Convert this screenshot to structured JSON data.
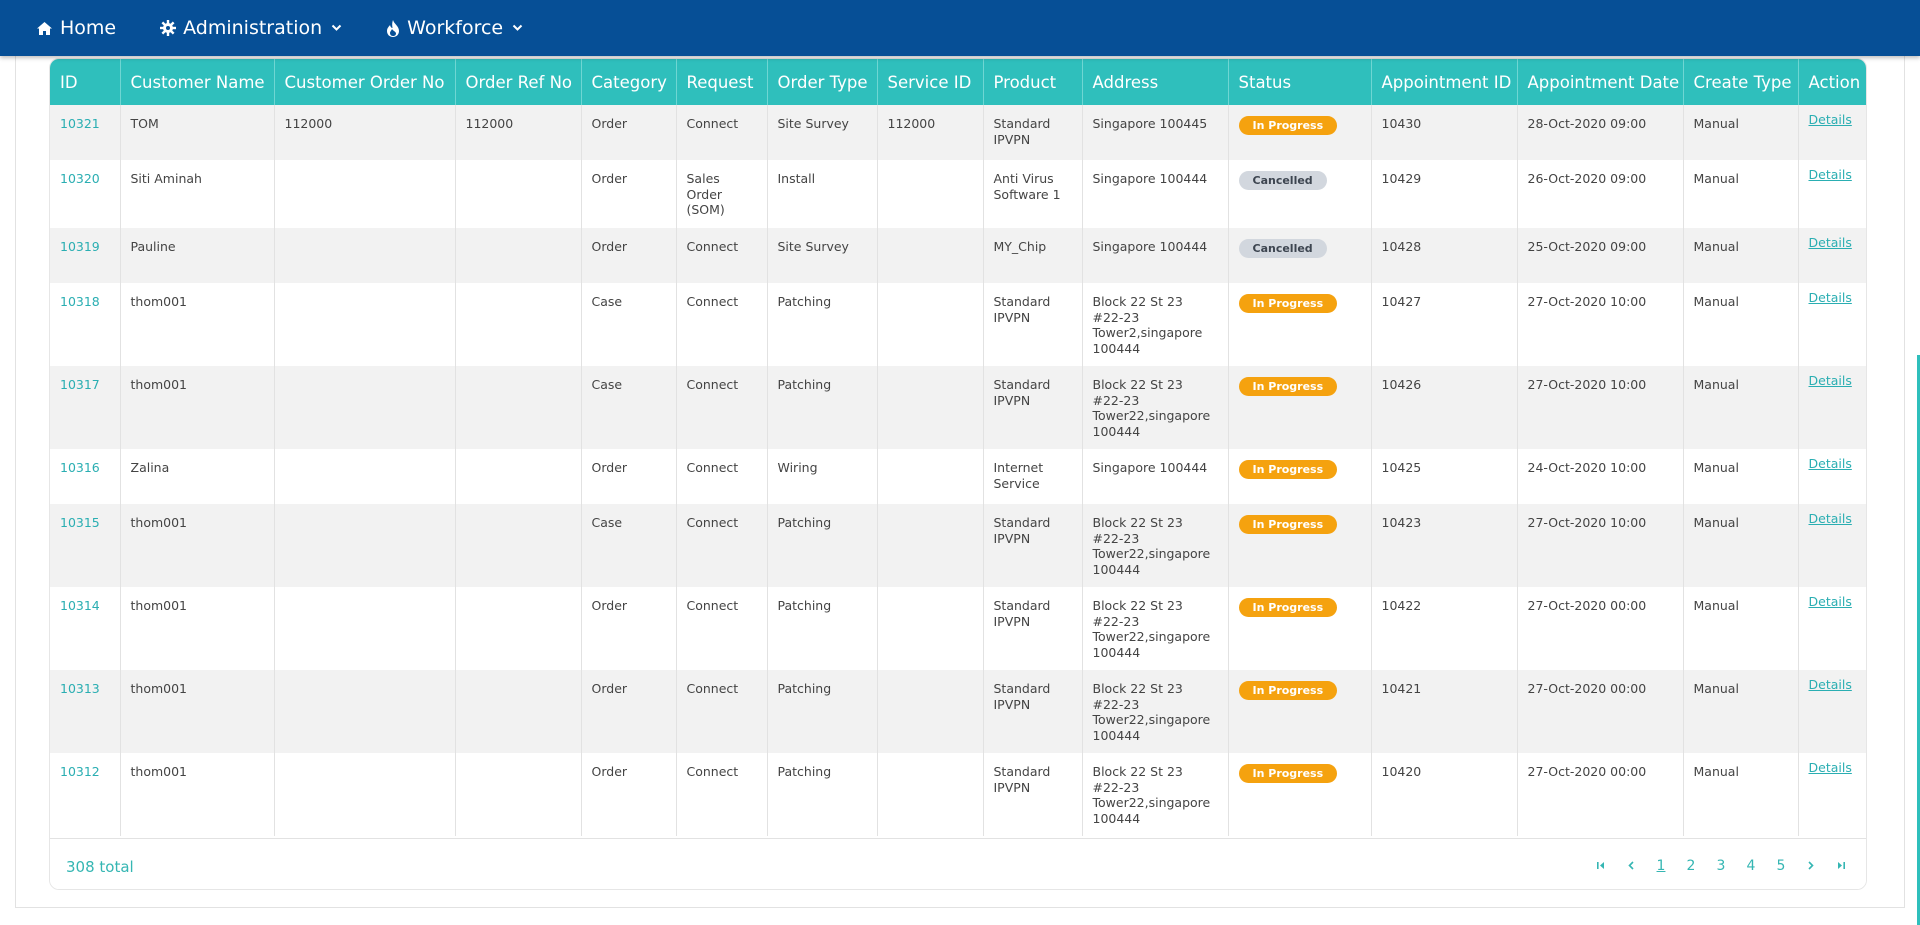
{
  "nav": {
    "home": "Home",
    "administration": "Administration",
    "workforce": "Workforce"
  },
  "table": {
    "headers": [
      "ID",
      "Customer Name",
      "Customer Order No",
      "Order Ref No",
      "Category",
      "Request",
      "Order Type",
      "Service ID",
      "Product",
      "Address",
      "Status",
      "Appointment ID",
      "Appointment Date",
      "Create Type",
      "Action"
    ],
    "rows": [
      {
        "id": "10321",
        "customer": "TOM",
        "custOrder": "112000",
        "orderRef": "112000",
        "category": "Order",
        "request": "Connect",
        "orderType": "Site Survey",
        "serviceId": "112000",
        "product": "Standard IPVPN",
        "address": "Singapore 100445",
        "status": "In Progress",
        "apptId": "10430",
        "apptDate": "28-Oct-2020 09:00",
        "createType": "Manual",
        "action": "Details"
      },
      {
        "id": "10320",
        "customer": "Siti Aminah",
        "custOrder": "",
        "orderRef": "",
        "category": "Order",
        "request": "Sales Order (SOM)",
        "orderType": "Install",
        "serviceId": "",
        "product": "Anti Virus Software 1",
        "address": "Singapore 100444",
        "status": "Cancelled",
        "apptId": "10429",
        "apptDate": "26-Oct-2020 09:00",
        "createType": "Manual",
        "action": "Details"
      },
      {
        "id": "10319",
        "customer": "Pauline",
        "custOrder": "",
        "orderRef": "",
        "category": "Order",
        "request": "Connect",
        "orderType": "Site Survey",
        "serviceId": "",
        "product": "MY_Chip",
        "address": "Singapore 100444",
        "status": "Cancelled",
        "apptId": "10428",
        "apptDate": "25-Oct-2020 09:00",
        "createType": "Manual",
        "action": "Details"
      },
      {
        "id": "10318",
        "customer": "thom001",
        "custOrder": "",
        "orderRef": "",
        "category": "Case",
        "request": "Connect",
        "orderType": "Patching",
        "serviceId": "",
        "product": "Standard IPVPN",
        "address": "Block 22 St 23 #22-23 Tower2,singapore 100444",
        "status": "In Progress",
        "apptId": "10427",
        "apptDate": "27-Oct-2020 10:00",
        "createType": "Manual",
        "action": "Details"
      },
      {
        "id": "10317",
        "customer": "thom001",
        "custOrder": "",
        "orderRef": "",
        "category": "Case",
        "request": "Connect",
        "orderType": "Patching",
        "serviceId": "",
        "product": "Standard IPVPN",
        "address": "Block 22 St 23 #22-23 Tower22,singapore 100444",
        "status": "In Progress",
        "apptId": "10426",
        "apptDate": "27-Oct-2020 10:00",
        "createType": "Manual",
        "action": "Details"
      },
      {
        "id": "10316",
        "customer": "Zalina",
        "custOrder": "",
        "orderRef": "",
        "category": "Order",
        "request": "Connect",
        "orderType": "Wiring",
        "serviceId": "",
        "product": "Internet Service",
        "address": "Singapore 100444",
        "status": "In Progress",
        "apptId": "10425",
        "apptDate": "24-Oct-2020 10:00",
        "createType": "Manual",
        "action": "Details"
      },
      {
        "id": "10315",
        "customer": "thom001",
        "custOrder": "",
        "orderRef": "",
        "category": "Case",
        "request": "Connect",
        "orderType": "Patching",
        "serviceId": "",
        "product": "Standard IPVPN",
        "address": "Block 22 St 23 #22-23 Tower22,singapore 100444",
        "status": "In Progress",
        "apptId": "10423",
        "apptDate": "27-Oct-2020 10:00",
        "createType": "Manual",
        "action": "Details"
      },
      {
        "id": "10314",
        "customer": "thom001",
        "custOrder": "",
        "orderRef": "",
        "category": "Order",
        "request": "Connect",
        "orderType": "Patching",
        "serviceId": "",
        "product": "Standard IPVPN",
        "address": "Block 22 St 23 #22-23 Tower22,singapore 100444",
        "status": "In Progress",
        "apptId": "10422",
        "apptDate": "27-Oct-2020 00:00",
        "createType": "Manual",
        "action": "Details"
      },
      {
        "id": "10313",
        "customer": "thom001",
        "custOrder": "",
        "orderRef": "",
        "category": "Order",
        "request": "Connect",
        "orderType": "Patching",
        "serviceId": "",
        "product": "Standard IPVPN",
        "address": "Block 22 St 23 #22-23 Tower22,singapore 100444",
        "status": "In Progress",
        "apptId": "10421",
        "apptDate": "27-Oct-2020 00:00",
        "createType": "Manual",
        "action": "Details"
      },
      {
        "id": "10312",
        "customer": "thom001",
        "custOrder": "",
        "orderRef": "",
        "category": "Order",
        "request": "Connect",
        "orderType": "Patching",
        "serviceId": "",
        "product": "Standard IPVPN",
        "address": "Block 22 St 23 #22-23 Tower22,singapore 100444",
        "status": "In Progress",
        "apptId": "10420",
        "apptDate": "27-Oct-2020 00:00",
        "createType": "Manual",
        "action": "Details"
      }
    ]
  },
  "footer": {
    "total": "308 total",
    "pages": [
      "1",
      "2",
      "3",
      "4",
      "5"
    ],
    "current_page": "1"
  },
  "colors": {
    "nav_bg": "#064f96",
    "header_bg": "#2fbfbc",
    "in_progress": "#f5a20f",
    "cancelled": "#d2d7de",
    "link": "#2aaeb2"
  },
  "icons": {
    "home": "home-icon",
    "administration": "gear-icon",
    "workforce": "flame-icon"
  }
}
